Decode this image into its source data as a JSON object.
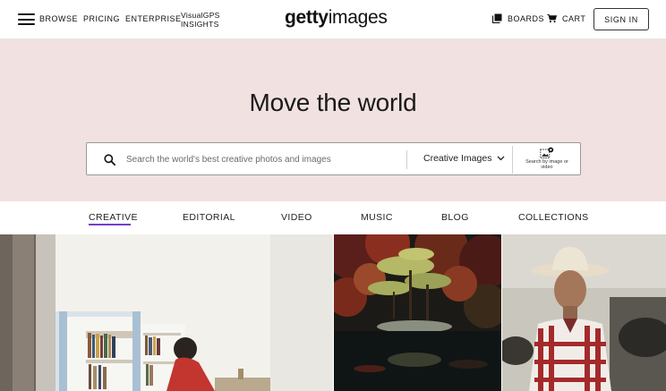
{
  "header": {
    "nav": {
      "browse": "BROWSE",
      "pricing": "PRICING",
      "enterprise": "ENTERPRISE",
      "visualgps_line1": "VisualGPS",
      "visualgps_line2": "INSIGHTS"
    },
    "logo": {
      "bold": "getty",
      "light": "images"
    },
    "boards": "BOARDS",
    "cart": "CART",
    "sign_in": "SIGN IN"
  },
  "hero": {
    "title": "Move the world",
    "background_color": "#f2e1e1",
    "search": {
      "placeholder": "Search the world's best creative photos and images",
      "value": "",
      "type_selected": "Creative Images",
      "search_by_image": "Search by image or video"
    }
  },
  "tabs": [
    {
      "label": "CREATIVE",
      "active": true
    },
    {
      "label": "EDITORIAL",
      "active": false
    },
    {
      "label": "VIDEO",
      "active": false
    },
    {
      "label": "MUSIC",
      "active": false
    },
    {
      "label": "BLOG",
      "active": false
    },
    {
      "label": "COLLECTIONS",
      "active": false
    }
  ],
  "colors": {
    "accent_underline": "#7a3cc9",
    "text": "#111111"
  },
  "icons": [
    "menu-icon",
    "boards-icon",
    "cart-icon",
    "search-icon",
    "chevron-down-icon",
    "image-search-icon"
  ]
}
